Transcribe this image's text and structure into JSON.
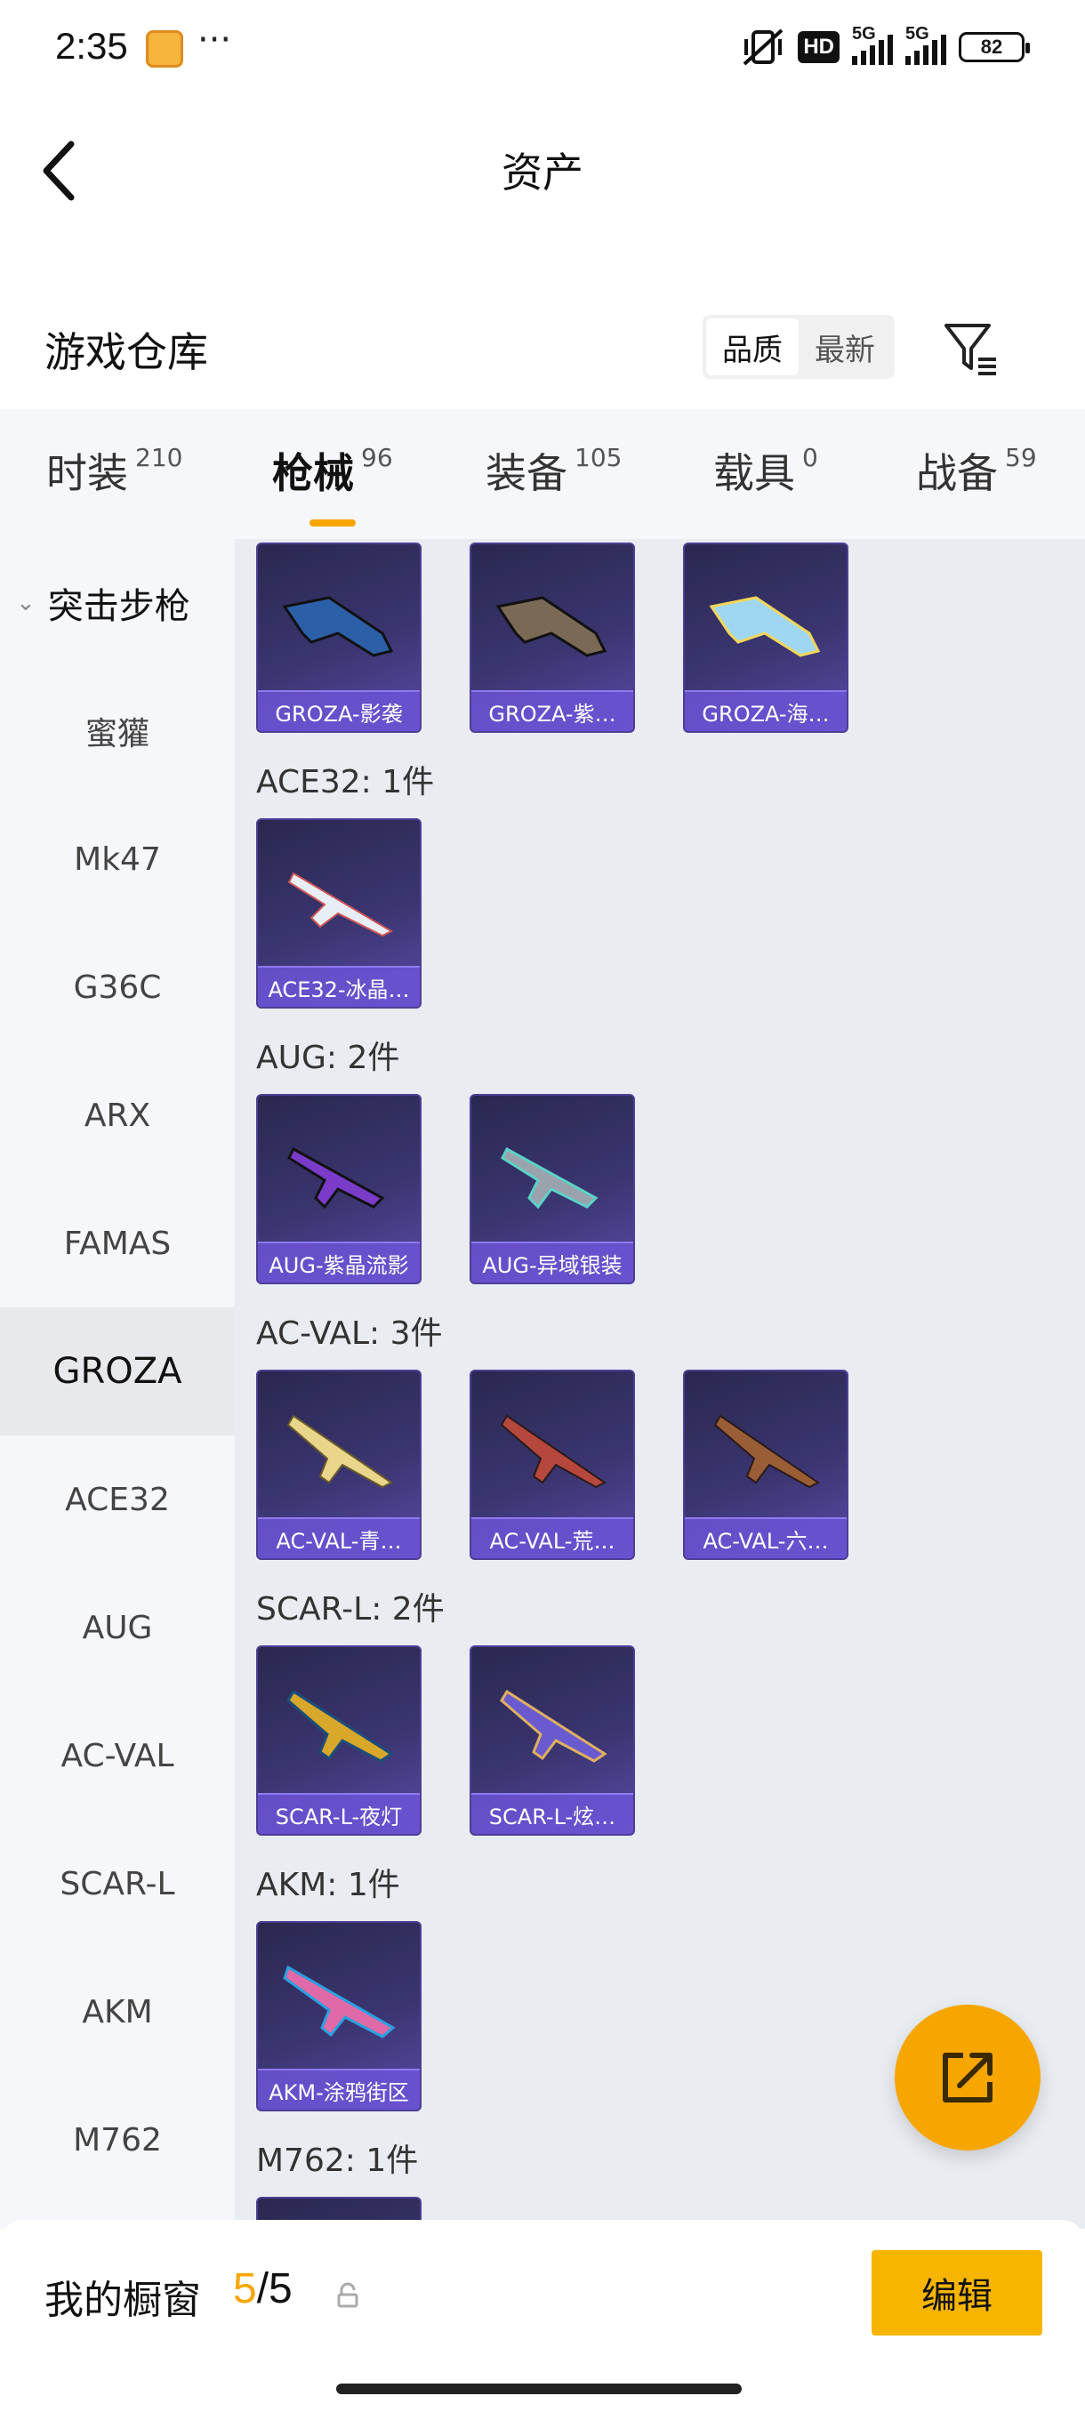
{
  "status": {
    "time": "2:35",
    "dots": "···",
    "hd": "HD",
    "net1": "5G",
    "net2": "5G",
    "battery": "82"
  },
  "header": {
    "title": "资产"
  },
  "section": {
    "title": "游戏仓库",
    "sort": [
      {
        "label": "品质",
        "active": true
      },
      {
        "label": "最新",
        "active": false
      }
    ]
  },
  "tabs": [
    {
      "label": "时装",
      "count": "210",
      "active": false
    },
    {
      "label": "枪械",
      "count": "96",
      "active": true
    },
    {
      "label": "装备",
      "count": "105",
      "active": false
    },
    {
      "label": "载具",
      "count": "0",
      "active": false
    },
    {
      "label": "战备",
      "count": "59",
      "active": false
    }
  ],
  "leftnav": {
    "group": {
      "label": "突击步枪",
      "chevron": "⌄"
    },
    "items": [
      "蜜獾",
      "Mk47",
      "G36C",
      "ARX",
      "FAMAS",
      "GROZA",
      "ACE32",
      "AUG",
      "AC-VAL",
      "SCAR-L",
      "AKM",
      "M762"
    ],
    "selected": "GROZA"
  },
  "content": {
    "top_cards": [
      "GROZA-影袭",
      "GROZA-紫…",
      "GROZA-海…"
    ],
    "groups": [
      {
        "label": "ACE32: 1件",
        "cards": [
          "ACE32-冰晶…"
        ]
      },
      {
        "label": "AUG: 2件",
        "cards": [
          "AUG-紫晶流影",
          "AUG-异域银装"
        ]
      },
      {
        "label": "AC-VAL: 3件",
        "cards": [
          "AC-VAL-青…",
          "AC-VAL-荒…",
          "AC-VAL-六…"
        ]
      },
      {
        "label": "SCAR-L: 2件",
        "cards": [
          "SCAR-L-夜灯",
          "SCAR-L-炫…"
        ]
      },
      {
        "label": "AKM: 1件",
        "cards": [
          "AKM-涂鸦街区"
        ]
      },
      {
        "label": "M762: 1件",
        "cards": [
          ""
        ]
      }
    ]
  },
  "bottombar": {
    "label": "我的橱窗",
    "current": "5",
    "sep": "/",
    "total": "5",
    "edit": "编辑"
  },
  "colors": {
    "accent": "#f7a600",
    "card_name_bg": "#6c54d6",
    "content_bg": "#e9ecf1"
  }
}
